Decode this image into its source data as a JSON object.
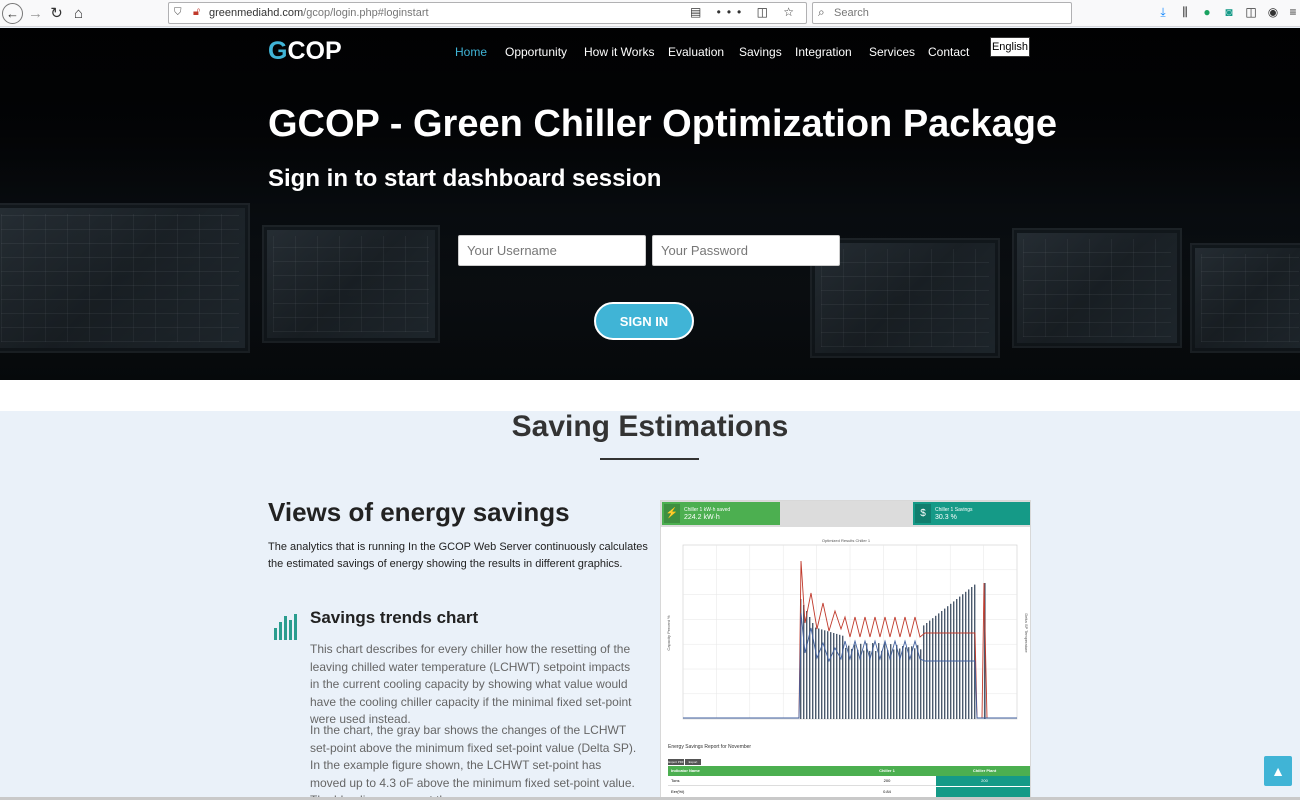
{
  "browser": {
    "url_domain": "greenmediahd.com",
    "url_path": "/gcop/login.php#loginstart",
    "search_placeholder": "Search"
  },
  "header": {
    "logo_first": "G",
    "logo_rest": "COP",
    "nav": [
      "Home",
      "Opportunity",
      "How it Works",
      "Evaluation",
      "Savings",
      "Integration",
      "Services",
      "Contact"
    ],
    "active_nav": "Home",
    "language": "English"
  },
  "hero": {
    "title": "GCOP - Green Chiller Optimization Package",
    "subtitle": "Sign in to start dashboard session",
    "username_placeholder": "Your Username",
    "password_placeholder": "Your Password",
    "signin_label": "SIGN IN"
  },
  "section": {
    "title": "Saving Estimations",
    "views_title": "Views of energy savings",
    "views_text": "The analytics that is running In the GCOP Web Server continuously calculates the estimated savings of energy showing the results in different graphics.",
    "trend_title": "Savings trends chart",
    "para1": "This chart describes for every chiller how the resetting of the leaving chilled water temperature (LCHWT) setpoint impacts in the current cooling capacity by showing what value would have the cooling chiller capacity if the minimal fixed set-point were used instead.",
    "para2": "In the chart, the gray bar shows the changes of the LCHWT set-point above the minimum fixed set-point value (Delta SP). In the example figure shown, the LCHWT set-point has moved up to 4.3 oF above the minimum fixed set-point value. The blue line represent the"
  },
  "dashboard": {
    "kpi1_label": "Chiller 1 kW·h saved",
    "kpi1_value": "224.2 kW·h",
    "kpi2_label": "Chiller 1 Savings",
    "kpi2_value": "30.3 %",
    "chart_title": "Optimized Results Chiller 1",
    "y_left_label": "Capacity Percent %",
    "y_right_label": "Delta SP Temperature",
    "report_title": "Energy Savings Report for November",
    "btn_pdf": "Export PDF",
    "btn_excel": "Export Excel",
    "table_headers": [
      "Indicator Name",
      "Chiller 1",
      "Chiller Plant"
    ],
    "table_rows": [
      [
        "Tons",
        "200",
        "200"
      ],
      [
        "Eer(%i)",
        "0.84",
        ""
      ]
    ]
  },
  "colors": {
    "accent": "#40b4d6",
    "green": "#4caf50",
    "teal": "#159a87",
    "section_bg": "#eaf1f9"
  }
}
